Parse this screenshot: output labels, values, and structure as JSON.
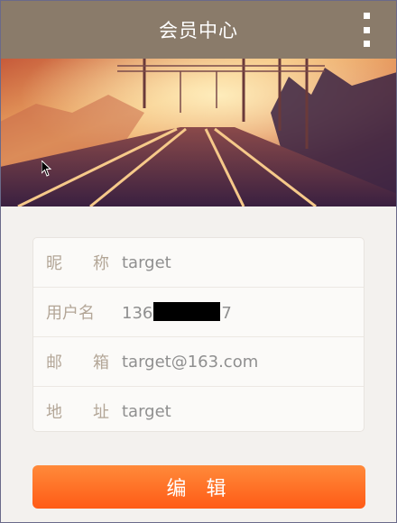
{
  "header": {
    "title": "会员中心",
    "menu_icon": "overflow-menu-icon"
  },
  "banner": {
    "image": "railway-tracks-sunset-photo"
  },
  "profile": {
    "nickname": {
      "label_chars": [
        "昵",
        "称"
      ],
      "value": "target"
    },
    "username": {
      "label": "用户名",
      "value_prefix": "136",
      "value_suffix": "7",
      "redacted": true
    },
    "email": {
      "label_chars": [
        "邮",
        "箱"
      ],
      "value": "target@163.com"
    },
    "address": {
      "label_chars": [
        "地",
        "址"
      ],
      "value": "target"
    }
  },
  "actions": {
    "edit_label": "编辑"
  },
  "colors": {
    "appbar": "#8a7b6a",
    "accent": "#ff6a22",
    "label": "#b3a697"
  }
}
